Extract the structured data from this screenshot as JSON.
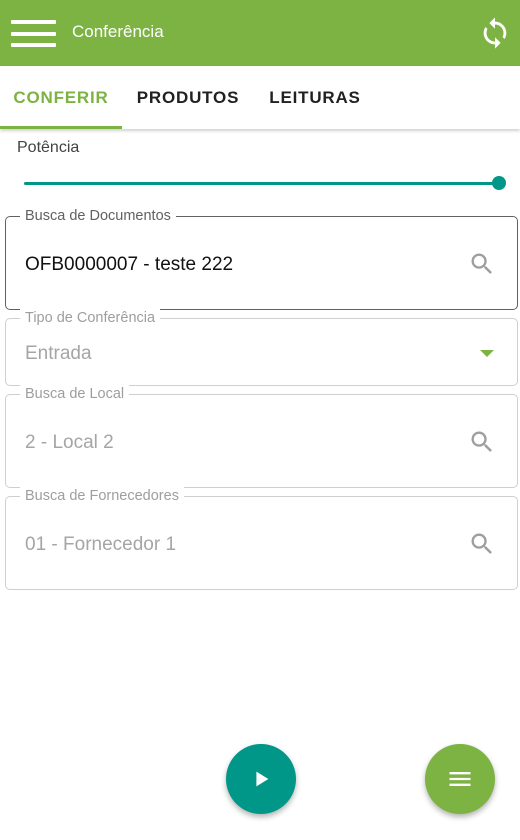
{
  "app_bar": {
    "title": "Conferência",
    "menu_icon": "hamburger-menu-icon",
    "sync_icon": "sync-icon",
    "color": "#7cb342"
  },
  "tabs": [
    {
      "label": "CONFERIR",
      "active": true
    },
    {
      "label": "PRODUTOS",
      "active": false
    },
    {
      "label": "LEITURAS",
      "active": false
    }
  ],
  "potencia": {
    "label": "Potência",
    "value_fraction": 1.0,
    "color": "#009688"
  },
  "busca_documentos": {
    "label": "Busca de Documentos",
    "value": "OFB0000007 - teste 222",
    "icon": "search-icon"
  },
  "tipo_conferencia": {
    "label": "Tipo de Conferência",
    "value": "Entrada",
    "icon": "dropdown-arrow-icon"
  },
  "busca_local": {
    "label": "Busca de Local",
    "value": "2 - Local 2",
    "icon": "search-icon"
  },
  "busca_fornecedores": {
    "label": "Busca de Fornecedores",
    "value": "01 - Fornecedor 1",
    "icon": "search-icon"
  },
  "fabs": {
    "play_icon": "play-icon",
    "play_color": "#009688",
    "menu_icon": "menu-icon",
    "menu_color": "#7cb342"
  }
}
